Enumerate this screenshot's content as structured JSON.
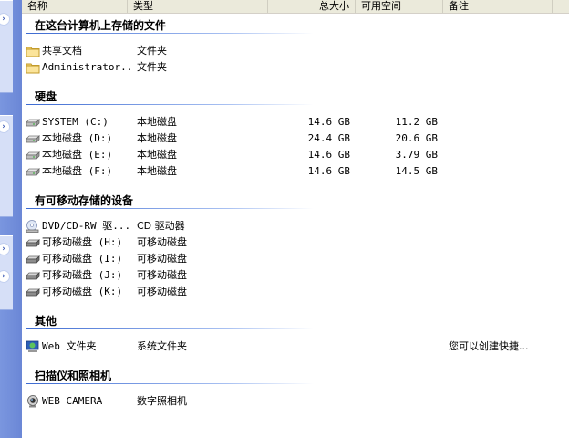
{
  "columns": {
    "name": "名称",
    "type": "类型",
    "total": "总大小",
    "free": "可用空间",
    "note": "备注"
  },
  "groups": [
    {
      "title": "在这台计算机上存储的文件",
      "items": [
        {
          "icon": "folder-icon",
          "name": "共享文档",
          "type": "文件夹",
          "total": "",
          "free": "",
          "note": ""
        },
        {
          "icon": "folder-icon",
          "name": "Administrator...",
          "type": "文件夹",
          "total": "",
          "free": "",
          "note": ""
        }
      ]
    },
    {
      "title": "硬盘",
      "items": [
        {
          "icon": "hard-disk-icon",
          "name": "SYSTEM (C:)",
          "type": "本地磁盘",
          "total": "14.6 GB",
          "free": "11.2 GB",
          "note": ""
        },
        {
          "icon": "hard-disk-icon",
          "name": "本地磁盘 (D:)",
          "type": "本地磁盘",
          "total": "24.4 GB",
          "free": "20.6 GB",
          "note": ""
        },
        {
          "icon": "hard-disk-icon",
          "name": "本地磁盘 (E:)",
          "type": "本地磁盘",
          "total": "14.6 GB",
          "free": "3.79 GB",
          "note": ""
        },
        {
          "icon": "hard-disk-icon",
          "name": "本地磁盘 (F:)",
          "type": "本地磁盘",
          "total": "14.6 GB",
          "free": "14.5 GB",
          "note": ""
        }
      ]
    },
    {
      "title": "有可移动存储的设备",
      "items": [
        {
          "icon": "cd-drive-icon",
          "name": "DVD/CD-RW 驱...",
          "type": "CD 驱动器",
          "total": "",
          "free": "",
          "note": ""
        },
        {
          "icon": "removable-disk-icon",
          "name": "可移动磁盘 (H:)",
          "type": "可移动磁盘",
          "total": "",
          "free": "",
          "note": ""
        },
        {
          "icon": "removable-disk-icon",
          "name": "可移动磁盘 (I:)",
          "type": "可移动磁盘",
          "total": "",
          "free": "",
          "note": ""
        },
        {
          "icon": "removable-disk-icon",
          "name": "可移动磁盘 (J:)",
          "type": "可移动磁盘",
          "total": "",
          "free": "",
          "note": ""
        },
        {
          "icon": "removable-disk-icon",
          "name": "可移动磁盘 (K:)",
          "type": "可移动磁盘",
          "total": "",
          "free": "",
          "note": ""
        }
      ]
    },
    {
      "title": "其他",
      "items": [
        {
          "icon": "web-folder-icon",
          "name": "Web 文件夹",
          "type": "系统文件夹",
          "total": "",
          "free": "",
          "note": "您可以创建快捷..."
        }
      ]
    },
    {
      "title": "扫描仪和照相机",
      "items": [
        {
          "icon": "camera-icon",
          "name": "WEB CAMERA",
          "type": "数字照相机",
          "total": "",
          "free": "",
          "note": ""
        }
      ]
    }
  ],
  "colors": {
    "group_line": "#3c6ad1",
    "left_pane": "#7a96df",
    "header_bg": "#ebeadb"
  }
}
